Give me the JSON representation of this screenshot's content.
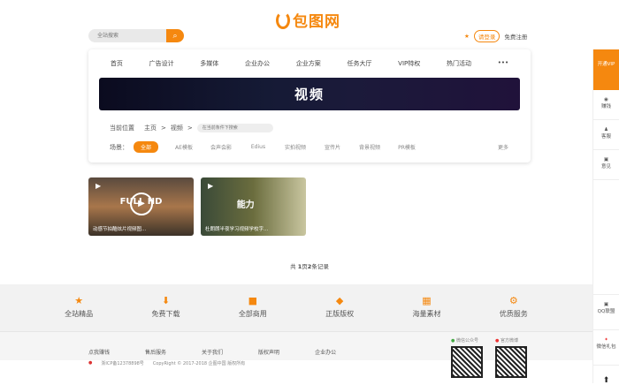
{
  "logo": {
    "text": "包图网"
  },
  "search": {
    "placeholder": "全站搜索"
  },
  "user": {
    "login": "请登录",
    "register": "免费注册"
  },
  "nav": [
    "首页",
    "广告设计",
    "多媒体",
    "企业办公",
    "企业方案",
    "任务大厅",
    "VIP特权",
    "热门活动",
    "•••"
  ],
  "banner": {
    "title": "视频"
  },
  "breadcrumb": {
    "label": "当前位置",
    "home": "主页",
    "sep": ">",
    "current": "视频",
    "placeholder": "在当前条件下搜索"
  },
  "scene": {
    "label": "场景：",
    "tags": [
      "全部",
      "AE模板",
      "会声会影",
      "Edius",
      "实拍视频",
      "宣传片",
      "背景视频",
      "PR模板"
    ],
    "more": "更多"
  },
  "videos": [
    {
      "title": "动感节拍酷炫片视频图...",
      "caption": "FULL HD"
    },
    {
      "title": "杜朗朗半夜学习视频学校字...",
      "caption": "能力"
    }
  ],
  "pager": {
    "pre": "共 ",
    "pages": "1",
    "mid": "页",
    "count": "2",
    "post": "条记录"
  },
  "features": [
    "全站精品",
    "免费下载",
    "全部商用",
    "正版版权",
    "海量素材",
    "优质服务"
  ],
  "footer": {
    "links": [
      "点我赚钱",
      "售后服务",
      "关于我们",
      "版权声明",
      "企业办公"
    ],
    "icp": "浙ICP备12378898号",
    "copyright": "CopyRight © 2017-2018 企图中国 版权所有",
    "wechat": "微信公众号",
    "weibo": "官方微博"
  },
  "sidebar": [
    "开通VIP",
    "赚钱",
    "客服",
    "意见",
    "QQ联盟",
    "微信礼包"
  ]
}
